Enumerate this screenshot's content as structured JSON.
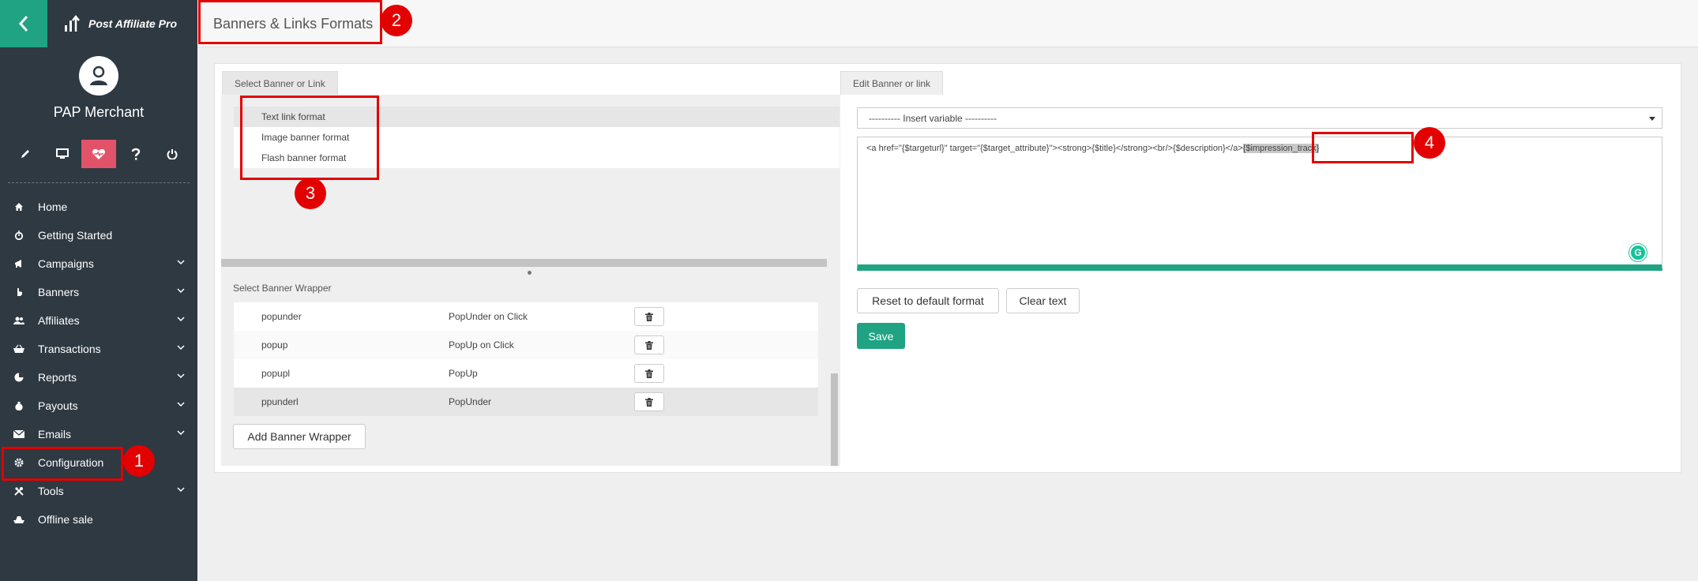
{
  "brand": {
    "name": "Post Affiliate Pro"
  },
  "user": {
    "name": "PAP Merchant"
  },
  "quick_icons": [
    "pencil-icon",
    "monitor-icon",
    "heart-pulse-icon",
    "question-icon",
    "power-icon"
  ],
  "nav": [
    {
      "label": "Home",
      "icon": "home-icon",
      "has_children": false
    },
    {
      "label": "Getting Started",
      "icon": "stopwatch-icon",
      "has_children": false
    },
    {
      "label": "Campaigns",
      "icon": "megaphone-icon",
      "has_children": true
    },
    {
      "label": "Banners",
      "icon": "hand-pointer-icon",
      "has_children": true
    },
    {
      "label": "Affiliates",
      "icon": "users-icon",
      "has_children": true
    },
    {
      "label": "Transactions",
      "icon": "basket-icon",
      "has_children": true
    },
    {
      "label": "Reports",
      "icon": "pie-chart-icon",
      "has_children": true
    },
    {
      "label": "Payouts",
      "icon": "money-bag-icon",
      "has_children": true
    },
    {
      "label": "Emails",
      "icon": "envelope-icon",
      "has_children": true
    },
    {
      "label": "Configuration",
      "icon": "gear-icon",
      "has_children": false
    },
    {
      "label": "Tools",
      "icon": "tools-icon",
      "has_children": true
    },
    {
      "label": "Offline sale",
      "icon": "offline-sale-icon",
      "has_children": false
    }
  ],
  "page": {
    "title": "Banners & Links Formats"
  },
  "left_panel": {
    "tab": "Select Banner or Link",
    "formats": [
      {
        "label": "Text link format",
        "selected": true
      },
      {
        "label": "Image banner format",
        "selected": false
      },
      {
        "label": "Flash banner format",
        "selected": false
      }
    ],
    "wrapper_title": "Select Banner Wrapper",
    "wrappers": [
      {
        "code": "popunder",
        "name": "PopUnder on Click"
      },
      {
        "code": "popup",
        "name": "PopUp on Click"
      },
      {
        "code": "popupl",
        "name": "PopUp"
      },
      {
        "code": "ppunderl",
        "name": "PopUnder"
      }
    ],
    "add_wrapper_label": "Add Banner Wrapper"
  },
  "right_panel": {
    "tab": "Edit Banner or link",
    "insert_variable": "---------- Insert variable ----------",
    "code": "<a href=\"{$targeturl}\" target=\"{$target_attribute}\"><strong>{$title}</strong><br/>{$description}</a>",
    "code_highlight": "{$impression_track}",
    "reset_label": "Reset to default format",
    "clear_label": "Clear text",
    "save_label": "Save"
  },
  "callouts": [
    "1",
    "2",
    "3",
    "4"
  ],
  "colors": {
    "accent": "#1fa383",
    "sidebar": "#2f3942",
    "active_icon_bg": "#e2536a",
    "callout": "#e30000"
  }
}
